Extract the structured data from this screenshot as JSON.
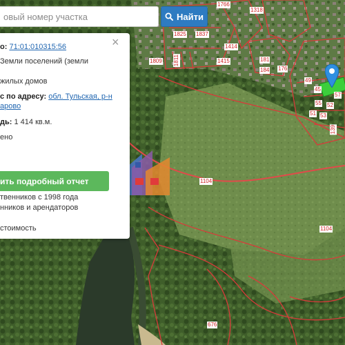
{
  "search": {
    "placeholder": "овый номер участка",
    "button_label": "Найти"
  },
  "panel": {
    "cadastral_label": "о:",
    "cadastral_link": "71:01:010315:56",
    "category_line1": "Земли поселений (земли",
    "usage": "жилых домов",
    "address_label": "с по адресу:",
    "address_link_1": "обл. Тульская, р-н",
    "address_link_2": "арово",
    "area_label": "дь:",
    "area_value": "1 414 кв.м.",
    "status": "ено",
    "report_button": "ить подробный отчет",
    "line_owners": "твенников с 1998 года",
    "line_tenants": "нников и арендаторов",
    "line_value": "стоимость"
  },
  "map_labels": [
    "1766",
    "1318",
    "1825",
    "1837",
    "1809",
    "1811",
    "1415",
    "1414",
    "181",
    "184",
    "176",
    "1104",
    "1104",
    "676",
    "57",
    "52",
    "55",
    "53",
    "51",
    "49",
    "45",
    "139"
  ],
  "colors": {
    "search_button": "#2e7bc1",
    "report_button": "#5cb85c",
    "link": "#1f65b0",
    "parcel_border": "#d93a3a",
    "selected_parcel": "#3ccf3c",
    "pin": "#2f8fe0"
  },
  "icons": {
    "search": "search-icon",
    "close": "close-icon",
    "pin": "map-pin-icon",
    "logo": "house-logo-icon"
  }
}
